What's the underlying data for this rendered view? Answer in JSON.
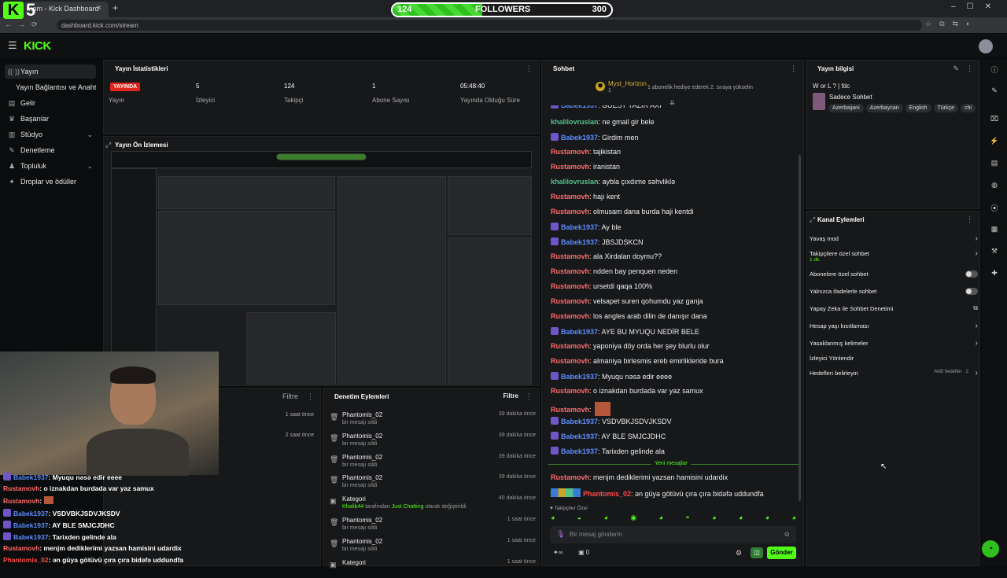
{
  "browser": {
    "tab_title": "...om - Kick Dashboard",
    "url": "dashboard.kick.com/stream"
  },
  "overlay": {
    "logo_letter": "K",
    "logo_number": "5",
    "followers": {
      "current": "124",
      "label": "FOLLOWERS",
      "goal": "300",
      "progress": 0.41
    }
  },
  "header": {
    "logo": "KICK"
  },
  "sidebar": {
    "items": [
      {
        "label": "Yayın",
        "icon": "broadcast-icon",
        "active": true
      },
      {
        "label": "Yayın Bağlantısı ve Anahtarı",
        "icon": ""
      },
      {
        "label": "Gelir",
        "icon": "revenue-icon"
      },
      {
        "label": "Başarılar",
        "icon": "trophy-icon"
      },
      {
        "label": "Stüdyo",
        "icon": "studio-icon",
        "chevron": true
      },
      {
        "label": "Denetleme",
        "icon": "moderation-icon"
      },
      {
        "label": "Topluluk",
        "icon": "community-icon",
        "chevron": true
      },
      {
        "label": "Droplar ve ödüller",
        "icon": "gift-icon"
      }
    ]
  },
  "stats": {
    "title": "Yayın İstatistikleri",
    "live_badge": "YAYINDA",
    "items": [
      {
        "value": "",
        "label": "Yayın"
      },
      {
        "value": "5",
        "label": "İzleyici"
      },
      {
        "value": "124",
        "label": "Takipçi"
      },
      {
        "value": "1",
        "label": "Abone Sayısı"
      },
      {
        "value": "05:48:40",
        "label": "Yayında Olduğu Süre"
      }
    ]
  },
  "preview": {
    "title": "Yayın Ön İzlemesi"
  },
  "left_filter": {
    "filter_label": "Filtre",
    "times": [
      "1 saat önce",
      "2 saat önce"
    ]
  },
  "overlay_chat": [
    {
      "user": "Babek1937",
      "text": ": Myuqu nəsə edir eeee",
      "color": "#5b8cff"
    },
    {
      "user": "Rustamovh",
      "text": ": o iznakdan burdada var yaz samux",
      "color": "#ff6b6b"
    },
    {
      "user": "Rustamovh",
      "text": ":",
      "color": "#ff6b6b"
    },
    {
      "user": "Babek1937",
      "text": ": VSDVBKJSDVJKSDV",
      "color": "#5b8cff"
    },
    {
      "user": "Babek1937",
      "text": ": AY BLE SMJCJDHC",
      "color": "#5b8cff"
    },
    {
      "user": "Babek1937",
      "text": ": Tarixden gelinde ala",
      "color": "#5b8cff"
    },
    {
      "user": "Rustamovh",
      "text": ": menjm dediklerimi yazsan hamisini udardix",
      "color": "#ff6b6b"
    },
    {
      "user": "Phantomis_02",
      "text": ": ən güya götüvü çıra çıra bidəfə uddundfa",
      "color": "#ff4b4b"
    }
  ],
  "mod_actions": {
    "title": "Denetim Eylemleri",
    "filter_label": "Filtre",
    "rows": [
      {
        "name": "Phantomis_02",
        "sub": "bir mesajı sildi",
        "time": "39 dakika önce"
      },
      {
        "name": "Phantomis_02",
        "sub": "bir mesajı sildi",
        "time": "39 dakika önce"
      },
      {
        "name": "Phantomis_02",
        "sub": "bir mesajı sildi",
        "time": "39 dakika önce"
      },
      {
        "name": "Phantomis_02",
        "sub": "bir mesajı sildi",
        "time": "39 dakika önce"
      },
      {
        "name": "Kategori",
        "sub_user": "Khalib44",
        "sub_mid": " tarafından ",
        "sub_cat": "Just Chatting",
        "sub_end": " olarak değiştirildi",
        "time": "40 dakika önce"
      },
      {
        "name": "Phantomis_02",
        "sub": "bir mesajı sildi",
        "time": "1 saat önce"
      },
      {
        "name": "Phantomis_02",
        "sub": "bir mesajı sildi",
        "time": "1 saat önce"
      },
      {
        "name": "Kategori",
        "sub": "",
        "time": "1 saat önce"
      }
    ]
  },
  "chat": {
    "title": "Sohbet",
    "pinned_user": "Myst_Horizon",
    "pinned_count": "1",
    "pinned_text": "1 abonelik hediye ederek 2. sıraya yükselin",
    "messages": [
      {
        "user": "Babek1937",
        "text": ": GUEST YAZIR AXI",
        "color": "#5b8cff",
        "badge": true
      },
      {
        "user": "khalilovruslan",
        "text": ": ne gmail gir bele",
        "color": "#53c28b"
      },
      {
        "user": "Babek1937",
        "text": ": Girdim men",
        "color": "#5b8cff",
        "badge": true
      },
      {
        "user": "Rustamovh",
        "text": ": tajikistan",
        "color": "#ff6b6b"
      },
      {
        "user": "Rustamovh",
        "text": ": iranistan",
        "color": "#ff6b6b"
      },
      {
        "user": "khalilovruslan",
        "text": ": aybla çıxdıme səhvliklə",
        "color": "#53c28b"
      },
      {
        "user": "Rustamovh",
        "text": ": hajı kent",
        "color": "#ff6b6b"
      },
      {
        "user": "Rustamovh",
        "text": ": olmusam dana burda haji kentdi",
        "color": "#ff6b6b"
      },
      {
        "user": "Babek1937",
        "text": ": Ay ble",
        "color": "#5b8cff",
        "badge": true
      },
      {
        "user": "Babek1937",
        "text": ": JBSJDSKCN",
        "color": "#5b8cff",
        "badge": true
      },
      {
        "user": "Rustamovh",
        "text": ": ala Xirdalan doymu??",
        "color": "#ff6b6b"
      },
      {
        "user": "Rustamovh",
        "text": ": ndden bay penquen neden",
        "color": "#ff6b6b"
      },
      {
        "user": "Rustamovh",
        "text": ": ursetdi qaqa 100%",
        "color": "#ff6b6b"
      },
      {
        "user": "Rustamovh",
        "text": ": velsapet suren qohumdu yaz ganja",
        "color": "#ff6b6b"
      },
      {
        "user": "Rustamovh",
        "text": ": los angles arab dilin de danışır dana",
        "color": "#ff6b6b"
      },
      {
        "user": "Babek1937",
        "text": ": AYE BU MYUQU NEDİR BELE",
        "color": "#5b8cff",
        "badge": true
      },
      {
        "user": "Rustamovh",
        "text": ": yaponiya döy orda her şey blurlu olur",
        "color": "#ff6b6b"
      },
      {
        "user": "Rustamovh",
        "text": ": almaniya birlesmis ereb emirlikleride bura",
        "color": "#ff6b6b"
      },
      {
        "user": "Babek1937",
        "text": ": Myuqu nəsə edir eeee",
        "color": "#5b8cff",
        "badge": true
      },
      {
        "user": "Rustamovh",
        "text": ": o iznakdan burdada var yaz samux",
        "color": "#ff6b6b"
      },
      {
        "user": "Rustamovh",
        "text": ":",
        "color": "#ff6b6b",
        "emote": true
      },
      {
        "user": "Babek1937",
        "text": ": VSDVBKJSDVJKSDV",
        "color": "#5b8cff",
        "badge": true
      },
      {
        "user": "Babek1937",
        "text": ": AY BLE SMJCJDHC",
        "color": "#5b8cff",
        "badge": true
      },
      {
        "user": "Babek1937",
        "text": ": Tarixden gelinde ala",
        "color": "#5b8cff",
        "badge": true
      }
    ],
    "new_messages": "Yeni mesajlar",
    "after": [
      {
        "user": "Rustamovh",
        "text": ": menjm dediklerimi yazsan hamisini udardix",
        "color": "#ff6b6b"
      },
      {
        "user": "Phantomis_02",
        "text": ": ən güya götüvü çıra çıra bidəfə uddundfa",
        "color": "#ff4b4b"
      }
    ],
    "followers_only": "Takipçiler Özel",
    "input_placeholder": "Bir mesaj gönderin",
    "count": "0",
    "send": "Gönder"
  },
  "stream_info": {
    "title": "Yayın bilgisi",
    "stream_title": "W or L ? | fdc",
    "category": "Sadece Sohbet",
    "tags": [
      "Azerbaijani",
      "Azerbaycan",
      "English",
      "Türkçe",
      "chi"
    ]
  },
  "channel_actions": {
    "title": "Kanal Eylemleri",
    "items": [
      {
        "label": "Yavaş mod",
        "control": "arrow"
      },
      {
        "label": "Takipçilere özel sohbet",
        "sub": "1 dk.",
        "control": "arrow"
      },
      {
        "label": "Abonelere özel sohbet",
        "control": "toggle"
      },
      {
        "label": "Yalnızca ifadelerle sohbet",
        "control": "toggle"
      },
      {
        "label": "Yapay Zeka ile Sohbet Denetimi",
        "control": "external"
      },
      {
        "label": "Hesap yaşı kısıtlaması",
        "control": "arrow"
      },
      {
        "label": "Yasaklanmış kelimeler",
        "control": "arrow"
      },
      {
        "label": "İzleyici Yönlendir",
        "control": "none"
      },
      {
        "label": "Hedefleri belirleyin",
        "status": "Aktif hedefler · 2",
        "control": "arrow"
      }
    ]
  }
}
